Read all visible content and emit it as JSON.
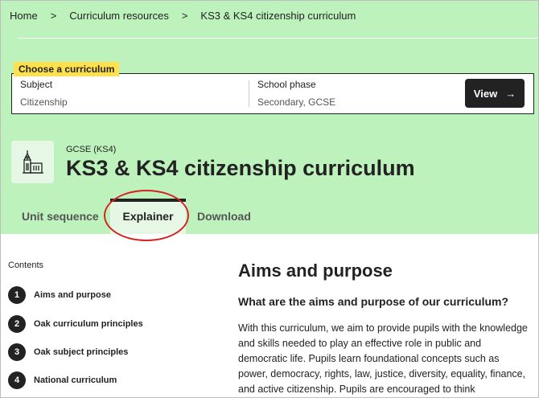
{
  "breadcrumb": {
    "items": [
      "Home",
      "Curriculum resources",
      "KS3 & KS4 citizenship curriculum"
    ],
    "separator": ">"
  },
  "picker": {
    "tag": "Choose a curriculum",
    "subject_label": "Subject",
    "subject_value": "Citizenship",
    "phase_label": "School phase",
    "phase_value": "Secondary, GCSE",
    "view_label": "View",
    "view_arrow": "→"
  },
  "header": {
    "level": "GCSE (KS4)",
    "title": "KS3 & KS4 citizenship curriculum"
  },
  "tabs": [
    {
      "label": "Unit sequence"
    },
    {
      "label": "Explainer"
    },
    {
      "label": "Download"
    }
  ],
  "contents": {
    "label": "Contents",
    "items": [
      {
        "num": "1",
        "label": "Aims and purpose"
      },
      {
        "num": "2",
        "label": "Oak curriculum principles"
      },
      {
        "num": "3",
        "label": "Oak subject principles"
      },
      {
        "num": "4",
        "label": "National curriculum"
      }
    ]
  },
  "main": {
    "heading": "Aims and purpose",
    "subheading": "What are the aims and purpose of our curriculum?",
    "paragraph": "With this curriculum, we aim to provide pupils with the knowledge and skills needed to play an effective role in public and democratic life. Pupils learn foundational concepts such as power, democracy, rights, law, justice, diversity, equality, finance, and active citizenship. Pupils are encouraged to think"
  },
  "colors": {
    "header_bg": "#bef2bd",
    "tag_bg": "#ffe14d",
    "annotation_ring": "#d62323"
  }
}
